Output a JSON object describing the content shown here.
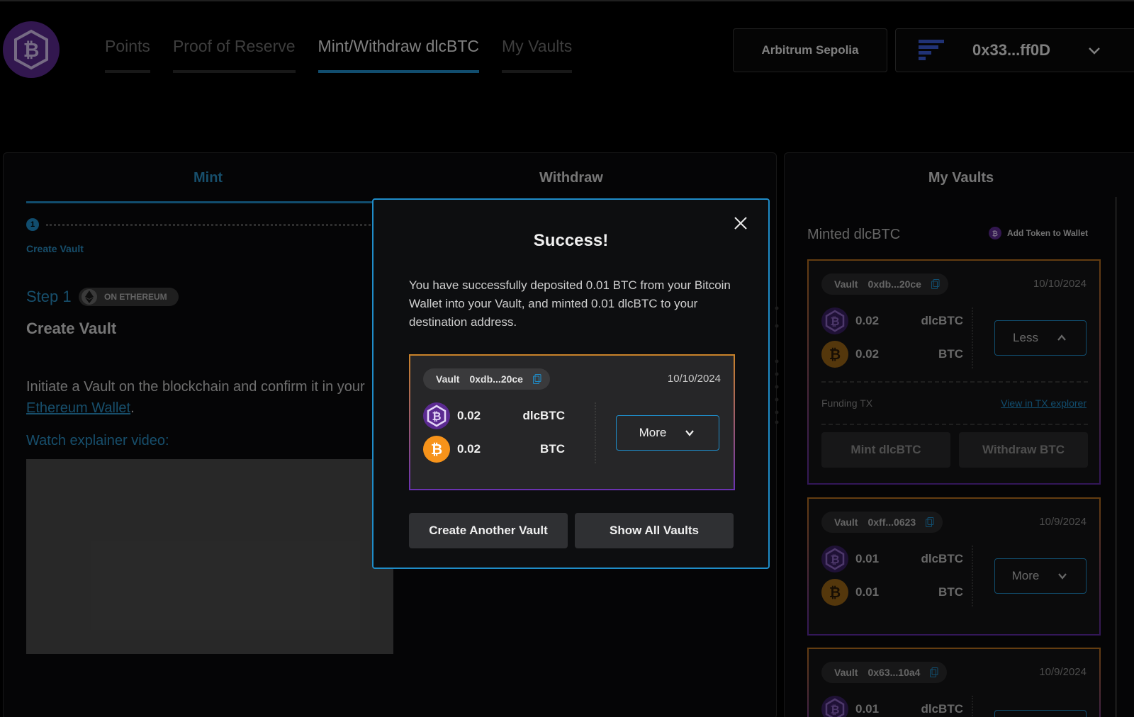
{
  "header": {
    "nav": [
      "Points",
      "Proof of Reserve",
      "Mint/Withdraw dlcBTC",
      "My Vaults"
    ],
    "active_nav": "Mint/Withdraw dlcBTC",
    "network": "Arbitrum Sepolia",
    "wallet_address": "0x33...ff0D"
  },
  "mint_panel": {
    "tabs": [
      "Mint",
      "Withdraw"
    ],
    "active_tab": "Mint",
    "step_number": "1",
    "step_label": "Create Vault",
    "step_title": "Step 1",
    "chain_badge": "ON ETHEREUM",
    "section_title": "Create Vault",
    "description_pre": "Initiate a Vault on the blockchain and confirm it in your ",
    "description_link": "Ethereum Wallet",
    "description_post": ".",
    "watch_label": "Watch explainer video:"
  },
  "vaults_panel": {
    "title": "My Vaults",
    "subtitle": "Minted dlcBTC",
    "add_token": "Add Token to Wallet",
    "vault_label": "Vault",
    "funding_label": "Funding TX",
    "funding_link": "View in TX explorer",
    "mint_action": "Mint dlcBTC",
    "withdraw_action": "Withdraw BTC",
    "vaults": [
      {
        "id": "0xdb...20ce",
        "date": "10/10/2024",
        "dlc_amount": "0.02",
        "dlc_symbol": "dlcBTC",
        "btc_amount": "0.02",
        "btc_symbol": "BTC",
        "toggle": "Less"
      },
      {
        "id": "0xff...0623",
        "date": "10/9/2024",
        "dlc_amount": "0.01",
        "dlc_symbol": "dlcBTC",
        "btc_amount": "0.01",
        "btc_symbol": "BTC",
        "toggle": "More"
      },
      {
        "id": "0x63...10a4",
        "date": "10/9/2024",
        "dlc_amount": "0.01",
        "dlc_symbol": "dlcBTC"
      }
    ]
  },
  "modal": {
    "title": "Success!",
    "message": "You have successfully deposited 0.01 BTC from your Bitcoin Wallet into your Vault, and minted 0.01 dlcBTC to your destination address.",
    "vault_label": "Vault",
    "vault_id": "0xdb...20ce",
    "date": "10/10/2024",
    "dlc_amount": "0.02",
    "dlc_symbol": "dlcBTC",
    "btc_amount": "0.02",
    "btc_symbol": "BTC",
    "more_label": "More",
    "create_another": "Create Another Vault",
    "show_all": "Show All Vaults"
  },
  "colors": {
    "accent": "#1f8cc8",
    "purple": "#5b2a91",
    "btc_orange": "#f7931a"
  }
}
